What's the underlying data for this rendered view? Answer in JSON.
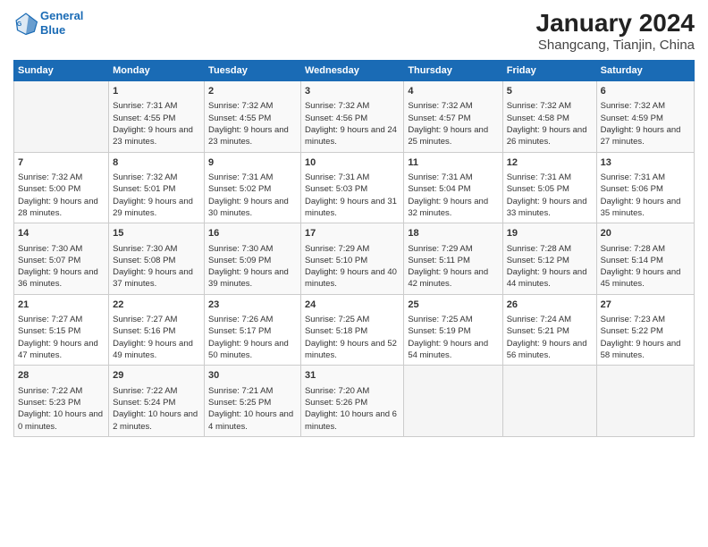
{
  "logo": {
    "line1": "General",
    "line2": "Blue"
  },
  "title": "January 2024",
  "subtitle": "Shangcang, Tianjin, China",
  "days_of_week": [
    "Sunday",
    "Monday",
    "Tuesday",
    "Wednesday",
    "Thursday",
    "Friday",
    "Saturday"
  ],
  "weeks": [
    [
      {
        "day": "",
        "empty": true
      },
      {
        "day": "1",
        "sunrise": "7:31 AM",
        "sunset": "4:55 PM",
        "daylight": "9 hours and 23 minutes."
      },
      {
        "day": "2",
        "sunrise": "7:32 AM",
        "sunset": "4:55 PM",
        "daylight": "9 hours and 23 minutes."
      },
      {
        "day": "3",
        "sunrise": "7:32 AM",
        "sunset": "4:56 PM",
        "daylight": "9 hours and 24 minutes."
      },
      {
        "day": "4",
        "sunrise": "7:32 AM",
        "sunset": "4:57 PM",
        "daylight": "9 hours and 25 minutes."
      },
      {
        "day": "5",
        "sunrise": "7:32 AM",
        "sunset": "4:58 PM",
        "daylight": "9 hours and 26 minutes."
      },
      {
        "day": "6",
        "sunrise": "7:32 AM",
        "sunset": "4:59 PM",
        "daylight": "9 hours and 27 minutes."
      }
    ],
    [
      {
        "day": "7",
        "sunrise": "7:32 AM",
        "sunset": "5:00 PM",
        "daylight": "9 hours and 28 minutes."
      },
      {
        "day": "8",
        "sunrise": "7:32 AM",
        "sunset": "5:01 PM",
        "daylight": "9 hours and 29 minutes."
      },
      {
        "day": "9",
        "sunrise": "7:31 AM",
        "sunset": "5:02 PM",
        "daylight": "9 hours and 30 minutes."
      },
      {
        "day": "10",
        "sunrise": "7:31 AM",
        "sunset": "5:03 PM",
        "daylight": "9 hours and 31 minutes."
      },
      {
        "day": "11",
        "sunrise": "7:31 AM",
        "sunset": "5:04 PM",
        "daylight": "9 hours and 32 minutes."
      },
      {
        "day": "12",
        "sunrise": "7:31 AM",
        "sunset": "5:05 PM",
        "daylight": "9 hours and 33 minutes."
      },
      {
        "day": "13",
        "sunrise": "7:31 AM",
        "sunset": "5:06 PM",
        "daylight": "9 hours and 35 minutes."
      }
    ],
    [
      {
        "day": "14",
        "sunrise": "7:30 AM",
        "sunset": "5:07 PM",
        "daylight": "9 hours and 36 minutes."
      },
      {
        "day": "15",
        "sunrise": "7:30 AM",
        "sunset": "5:08 PM",
        "daylight": "9 hours and 37 minutes."
      },
      {
        "day": "16",
        "sunrise": "7:30 AM",
        "sunset": "5:09 PM",
        "daylight": "9 hours and 39 minutes."
      },
      {
        "day": "17",
        "sunrise": "7:29 AM",
        "sunset": "5:10 PM",
        "daylight": "9 hours and 40 minutes."
      },
      {
        "day": "18",
        "sunrise": "7:29 AM",
        "sunset": "5:11 PM",
        "daylight": "9 hours and 42 minutes."
      },
      {
        "day": "19",
        "sunrise": "7:28 AM",
        "sunset": "5:12 PM",
        "daylight": "9 hours and 44 minutes."
      },
      {
        "day": "20",
        "sunrise": "7:28 AM",
        "sunset": "5:14 PM",
        "daylight": "9 hours and 45 minutes."
      }
    ],
    [
      {
        "day": "21",
        "sunrise": "7:27 AM",
        "sunset": "5:15 PM",
        "daylight": "9 hours and 47 minutes."
      },
      {
        "day": "22",
        "sunrise": "7:27 AM",
        "sunset": "5:16 PM",
        "daylight": "9 hours and 49 minutes."
      },
      {
        "day": "23",
        "sunrise": "7:26 AM",
        "sunset": "5:17 PM",
        "daylight": "9 hours and 50 minutes."
      },
      {
        "day": "24",
        "sunrise": "7:25 AM",
        "sunset": "5:18 PM",
        "daylight": "9 hours and 52 minutes."
      },
      {
        "day": "25",
        "sunrise": "7:25 AM",
        "sunset": "5:19 PM",
        "daylight": "9 hours and 54 minutes."
      },
      {
        "day": "26",
        "sunrise": "7:24 AM",
        "sunset": "5:21 PM",
        "daylight": "9 hours and 56 minutes."
      },
      {
        "day": "27",
        "sunrise": "7:23 AM",
        "sunset": "5:22 PM",
        "daylight": "9 hours and 58 minutes."
      }
    ],
    [
      {
        "day": "28",
        "sunrise": "7:22 AM",
        "sunset": "5:23 PM",
        "daylight": "10 hours and 0 minutes."
      },
      {
        "day": "29",
        "sunrise": "7:22 AM",
        "sunset": "5:24 PM",
        "daylight": "10 hours and 2 minutes."
      },
      {
        "day": "30",
        "sunrise": "7:21 AM",
        "sunset": "5:25 PM",
        "daylight": "10 hours and 4 minutes."
      },
      {
        "day": "31",
        "sunrise": "7:20 AM",
        "sunset": "5:26 PM",
        "daylight": "10 hours and 6 minutes."
      },
      {
        "day": "",
        "empty": true
      },
      {
        "day": "",
        "empty": true
      },
      {
        "day": "",
        "empty": true
      }
    ]
  ]
}
